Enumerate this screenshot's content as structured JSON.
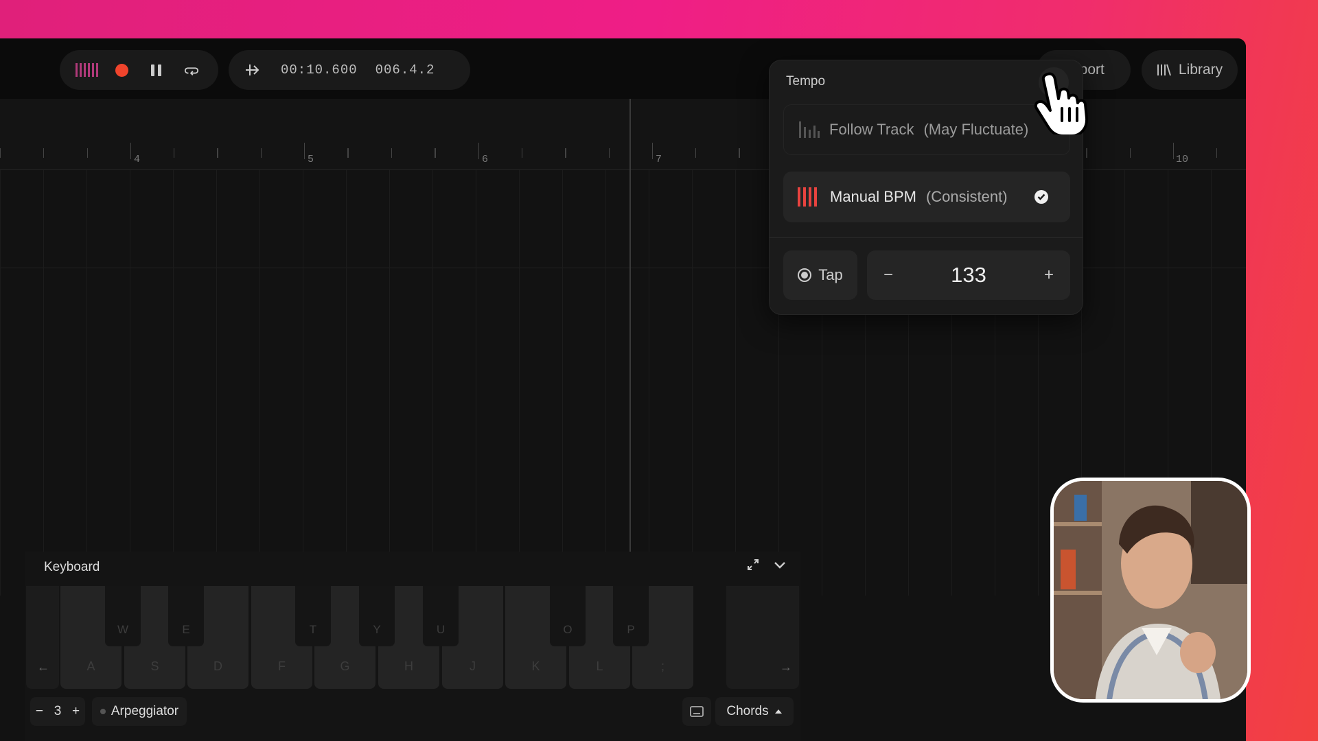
{
  "transport": {
    "timecode": "00:10.600",
    "position": "006.4.2"
  },
  "header": {
    "export_label": "Export",
    "library_label": "Library"
  },
  "ruler": {
    "bars": [
      "4",
      "5",
      "6",
      "7",
      "10"
    ]
  },
  "tempo": {
    "title": "Tempo",
    "follow_track": {
      "label": "Follow Track",
      "note": "(May Fluctuate)"
    },
    "manual_bpm": {
      "label": "Manual BPM",
      "note": "(Consistent)",
      "selected": true
    },
    "tap_label": "Tap",
    "bpm_value": "133",
    "minus": "−",
    "plus": "+"
  },
  "keyboard": {
    "title": "Keyboard",
    "white_keys": [
      "A",
      "S",
      "D",
      "F",
      "G",
      "H",
      "J",
      "K",
      "L",
      ";"
    ],
    "black_keys": [
      "W",
      "E",
      "T",
      "Y",
      "U",
      "O",
      "P"
    ],
    "octave": {
      "minus": "−",
      "value": "3",
      "plus": "+"
    },
    "arpeggiator_label": "Arpeggiator",
    "chords_label": "Chords",
    "left_arrow": "←",
    "right_arrow": "→"
  },
  "colors": {
    "accent": "#f0442c",
    "brand_bars": "#b03a7a",
    "manual_bars": "#e8433f"
  }
}
